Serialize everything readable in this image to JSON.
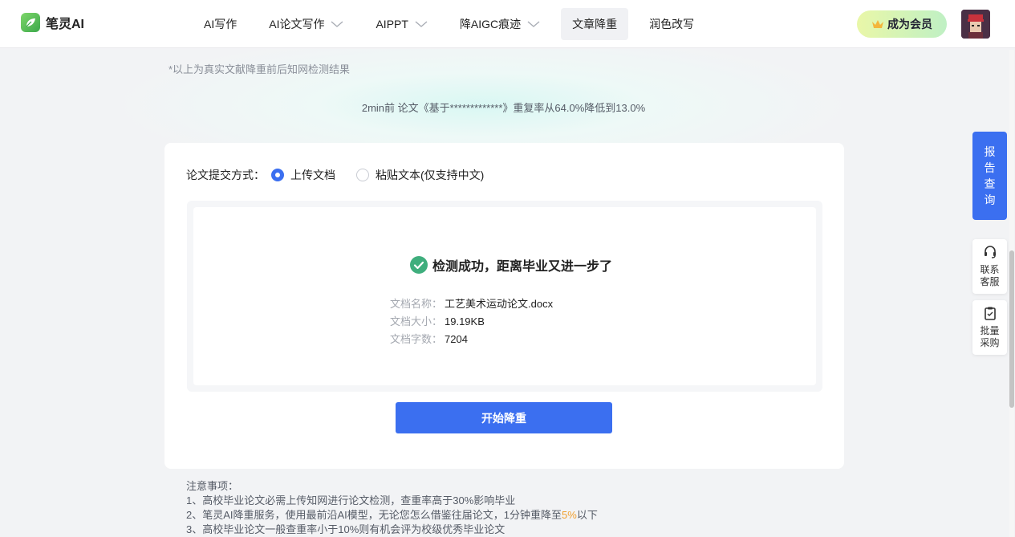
{
  "brand": {
    "name": "笔灵AI",
    "accent": "#3b6ff0"
  },
  "nav": {
    "items": [
      {
        "label": "AI写作",
        "has_dropdown": false,
        "active": false
      },
      {
        "label": "AI论文写作",
        "has_dropdown": true,
        "active": false
      },
      {
        "label": "AIPPT",
        "has_dropdown": true,
        "active": false
      },
      {
        "label": "降AIGC痕迹",
        "has_dropdown": true,
        "active": false
      },
      {
        "label": "文章降重",
        "has_dropdown": false,
        "active": true
      },
      {
        "label": "润色改写",
        "has_dropdown": false,
        "active": false
      }
    ],
    "member_label": "成为会员"
  },
  "banner": {
    "note": "*以上为真实文献降重前后知网检测结果",
    "record": "2min前 论文《基于*************》重复率从64.0%降低到13.0%"
  },
  "form": {
    "submit_label": "论文提交方式：",
    "options": [
      {
        "label": "上传文档",
        "selected": true
      },
      {
        "label": "粘贴文本(仅支持中文)",
        "selected": false
      }
    ]
  },
  "result": {
    "success_text": "检测成功，距离毕业又进一步了",
    "rows": [
      {
        "label": "文档名称：",
        "value": "工艺美术运动论文.docx"
      },
      {
        "label": "文档大小：",
        "value": "19.19KB"
      },
      {
        "label": "文档字数：",
        "value": "7204"
      }
    ]
  },
  "start_button": "开始降重",
  "notes": {
    "title": "注意事项：",
    "line1": "1、高校毕业论文必需上传知网进行论文检测，查重率高于30%影响毕业",
    "line2_pre": "2、笔灵AI降重服务，使用最前沿AI模型，无论您怎么借鉴往届论文，1分钟重降至",
    "line2_hl": "5%",
    "line2_post": "以下",
    "line3": "3、高校毕业论文一般查重率小于10%则有机会评为校级优秀毕业论文"
  },
  "side": {
    "query_label": "报告查询",
    "tools": [
      {
        "label": "联系客服",
        "icon": "headset-icon"
      },
      {
        "label": "批量采购",
        "icon": "clipboard-icon"
      }
    ]
  }
}
